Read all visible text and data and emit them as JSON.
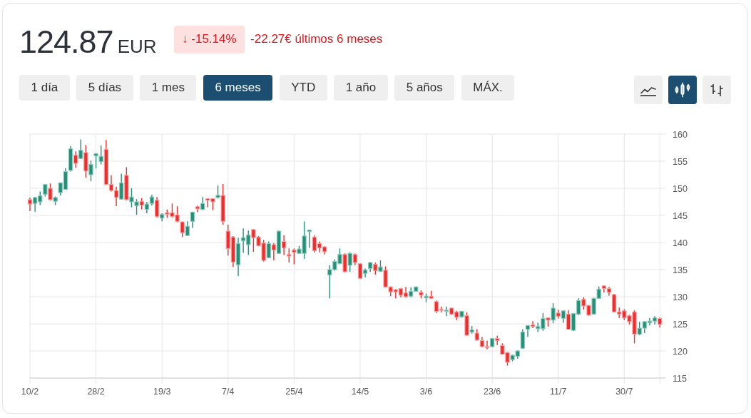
{
  "quote": {
    "price": "124.87",
    "currency": "EUR"
  },
  "change": {
    "badge": "↓ -15.14%",
    "period": "-22.27€ últimos 6 meses"
  },
  "ranges": [
    {
      "label": "1 día",
      "selected": false
    },
    {
      "label": "5 días",
      "selected": false
    },
    {
      "label": "1 mes",
      "selected": false
    },
    {
      "label": "6 meses",
      "selected": true
    },
    {
      "label": "YTD",
      "selected": false
    },
    {
      "label": "1 año",
      "selected": false
    },
    {
      "label": "5 años",
      "selected": false
    },
    {
      "label": "MÁX.",
      "selected": false
    }
  ],
  "chart_types": [
    {
      "kind": "line",
      "selected": false
    },
    {
      "kind": "candlestick",
      "selected": true
    },
    {
      "kind": "ohlc",
      "selected": false
    }
  ],
  "chart": {
    "chart_data": {
      "type": "candlestick",
      "grid": true,
      "ylim": [
        115,
        160
      ],
      "yticks": [
        115,
        120,
        125,
        130,
        135,
        140,
        145,
        150,
        155,
        160
      ],
      "categories": [
        "10/2",
        null,
        null,
        null,
        null,
        null,
        null,
        null,
        null,
        null,
        null,
        null,
        null,
        "28/2",
        null,
        null,
        null,
        null,
        null,
        null,
        null,
        null,
        null,
        null,
        null,
        null,
        "19/3",
        null,
        null,
        null,
        null,
        null,
        null,
        null,
        null,
        null,
        null,
        null,
        null,
        "7/4",
        null,
        null,
        null,
        null,
        null,
        null,
        null,
        null,
        null,
        null,
        null,
        null,
        "25/4",
        null,
        null,
        null,
        null,
        null,
        null,
        null,
        null,
        null,
        null,
        null,
        null,
        "14/5",
        null,
        null,
        null,
        null,
        null,
        null,
        null,
        null,
        null,
        null,
        null,
        null,
        "3/6",
        null,
        null,
        null,
        null,
        null,
        null,
        null,
        null,
        null,
        null,
        null,
        null,
        "23/6",
        null,
        null,
        null,
        null,
        null,
        null,
        null,
        null,
        null,
        null,
        null,
        null,
        "11/7",
        null,
        null,
        null,
        null,
        null,
        null,
        null,
        null,
        null,
        null,
        null,
        null,
        "30/7",
        null,
        null,
        null,
        null,
        null,
        null,
        null
      ],
      "ohlc": [
        [
          147.9,
          148.3,
          145.8,
          147.1
        ],
        [
          147.2,
          148.4,
          145.7,
          148.3
        ],
        [
          147.5,
          149.4,
          146.9,
          148.6
        ],
        [
          148.9,
          150.8,
          148.5,
          150.7
        ],
        [
          150.0,
          150.9,
          147.8,
          147.9
        ],
        [
          147.6,
          148.5,
          146.9,
          148.3
        ],
        [
          149.2,
          151.1,
          148.7,
          151.0
        ],
        [
          149.8,
          153.7,
          149.7,
          153.1
        ],
        [
          153.3,
          157.8,
          153.1,
          157.3
        ],
        [
          156.1,
          156.8,
          153.8,
          154.6
        ],
        [
          155.5,
          159.0,
          155.4,
          157.0
        ],
        [
          156.6,
          158.0,
          152.0,
          153.2
        ],
        [
          152.5,
          155.1,
          151.3,
          154.4
        ],
        [
          156.0,
          156.5,
          153.7,
          156.4
        ],
        [
          154.9,
          157.9,
          154.4,
          155.9
        ],
        [
          157.2,
          158.9,
          150.6,
          150.7
        ],
        [
          150.7,
          152.4,
          149.4,
          149.6
        ],
        [
          149.6,
          150.3,
          146.7,
          148.3
        ],
        [
          148.0,
          152.7,
          147.9,
          151.0
        ],
        [
          152.4,
          153.9,
          147.8,
          147.9
        ],
        [
          147.5,
          150.0,
          146.5,
          148.4
        ],
        [
          146.8,
          148.0,
          145.1,
          147.5
        ],
        [
          147.6,
          148.2,
          146.1,
          146.9
        ],
        [
          146.1,
          147.5,
          145.4,
          147.1
        ],
        [
          147.2,
          148.8,
          146.8,
          148.4
        ],
        [
          147.8,
          148.4,
          144.6,
          144.8
        ],
        [
          144.5,
          145.4,
          143.9,
          145.2
        ],
        [
          145.5,
          146.1,
          144.6,
          145.2
        ],
        [
          145.5,
          147.2,
          144.6,
          144.8
        ],
        [
          145.1,
          146.7,
          143.7,
          143.9
        ],
        [
          143.8,
          143.9,
          141.0,
          141.8
        ],
        [
          141.3,
          143.9,
          141.2,
          143.0
        ],
        [
          143.9,
          145.7,
          142.7,
          145.6
        ],
        [
          146.6,
          146.8,
          145.6,
          146.2
        ],
        [
          146.1,
          148.4,
          146.0,
          147.2
        ],
        [
          148.1,
          148.2,
          146.5,
          147.8
        ],
        [
          148.1,
          148.2,
          146.0,
          147.5
        ],
        [
          148.3,
          150.5,
          148.1,
          148.7
        ],
        [
          148.7,
          150.8,
          143.3,
          143.9
        ],
        [
          142.1,
          143.3,
          137.6,
          138.9
        ],
        [
          141.0,
          141.2,
          135.5,
          136.4
        ],
        [
          135.9,
          140.9,
          133.8,
          139.8
        ],
        [
          140.3,
          142.6,
          138.1,
          140.9
        ],
        [
          139.6,
          142.2,
          137.7,
          141.4
        ],
        [
          142.4,
          142.4,
          138.3,
          140.9
        ],
        [
          141.0,
          141.2,
          139.3,
          139.4
        ],
        [
          139.9,
          140.5,
          136.5,
          136.7
        ],
        [
          137.2,
          140.2,
          137.1,
          139.8
        ],
        [
          139.6,
          139.9,
          136.7,
          138.6
        ],
        [
          138.0,
          142.2,
          137.9,
          142.1
        ],
        [
          140.2,
          141.3,
          137.7,
          139.0
        ],
        [
          137.8,
          138.9,
          136.3,
          137.5
        ],
        [
          138.6,
          138.9,
          136.0,
          138.2
        ],
        [
          138.0,
          139.4,
          137.9,
          138.8
        ],
        [
          138.0,
          143.9,
          137.0,
          141.2
        ],
        [
          142.0,
          142.4,
          139.0,
          142.3
        ],
        [
          141.0,
          141.3,
          138.2,
          138.5
        ],
        [
          139.8,
          140.2,
          138.2,
          139.0
        ],
        [
          139.2,
          139.3,
          137.8,
          138.3
        ],
        [
          134.0,
          135.8,
          129.7,
          135.0
        ],
        [
          135.0,
          136.9,
          134.8,
          136.5
        ],
        [
          136.1,
          138.9,
          136.0,
          137.8
        ],
        [
          137.8,
          138.0,
          134.5,
          134.6
        ],
        [
          135.8,
          138.2,
          134.6,
          138.0
        ],
        [
          137.8,
          138.0,
          135.8,
          136.3
        ],
        [
          136.1,
          136.2,
          133.3,
          133.4
        ],
        [
          134.3,
          135.2,
          133.6,
          134.9
        ],
        [
          135.2,
          136.4,
          134.6,
          136.3
        ],
        [
          136.0,
          136.3,
          134.1,
          134.8
        ],
        [
          134.7,
          136.7,
          134.6,
          135.5
        ],
        [
          134.9,
          135.6,
          131.7,
          131.8
        ],
        [
          131.8,
          131.9,
          130.1,
          130.9
        ],
        [
          131.3,
          131.4,
          129.7,
          130.9
        ],
        [
          131.5,
          131.6,
          129.9,
          130.3
        ],
        [
          130.7,
          131.8,
          129.8,
          130.0
        ],
        [
          130.1,
          131.7,
          129.9,
          131.0
        ],
        [
          131.0,
          131.9,
          130.9,
          131.8
        ],
        [
          130.8,
          131.2,
          129.7,
          130.3
        ],
        [
          129.8,
          130.6,
          129.0,
          130.1
        ],
        [
          130.1,
          131.1,
          129.6,
          129.7
        ],
        [
          129.1,
          129.3,
          127.0,
          127.3
        ],
        [
          127.7,
          128.2,
          127.1,
          127.5
        ],
        [
          127.3,
          128.2,
          126.4,
          127.5
        ],
        [
          127.9,
          128.0,
          126.6,
          126.8
        ],
        [
          127.2,
          127.4,
          125.7,
          126.2
        ],
        [
          126.3,
          127.4,
          126.1,
          127.3
        ],
        [
          126.5,
          127.1,
          122.8,
          122.9
        ],
        [
          123.5,
          124.6,
          123.2,
          123.9
        ],
        [
          123.3,
          124.0,
          121.9,
          122.0
        ],
        [
          121.9,
          122.6,
          120.7,
          120.8
        ],
        [
          120.8,
          121.9,
          120.3,
          120.6
        ],
        [
          120.8,
          122.4,
          120.7,
          122.3
        ],
        [
          122.3,
          122.8,
          121.1,
          121.9
        ],
        [
          121.0,
          121.4,
          119.3,
          119.4
        ],
        [
          119.7,
          119.8,
          117.3,
          117.9
        ],
        [
          118.4,
          119.3,
          118.1,
          119.2
        ],
        [
          119.0,
          120.1,
          118.6,
          120.0
        ],
        [
          120.5,
          124.0,
          120.4,
          123.5
        ],
        [
          124.0,
          124.7,
          122.6,
          124.7
        ],
        [
          124.8,
          125.5,
          124.2,
          124.5
        ],
        [
          124.1,
          125.2,
          123.5,
          124.5
        ],
        [
          124.1,
          127.0,
          123.7,
          126.0
        ],
        [
          126.1,
          126.2,
          124.5,
          125.7
        ],
        [
          125.7,
          128.8,
          125.1,
          127.9
        ],
        [
          127.0,
          127.6,
          126.0,
          126.4
        ],
        [
          126.0,
          127.5,
          125.2,
          127.4
        ],
        [
          126.8,
          127.5,
          123.9,
          124.0
        ],
        [
          123.8,
          127.0,
          123.7,
          126.9
        ],
        [
          126.8,
          129.7,
          126.6,
          129.3
        ],
        [
          129.5,
          129.9,
          127.6,
          128.3
        ],
        [
          128.4,
          128.5,
          126.5,
          126.6
        ],
        [
          126.8,
          129.8,
          126.7,
          129.7
        ],
        [
          129.7,
          131.9,
          129.6,
          131.4
        ],
        [
          132.0,
          132.1,
          130.8,
          131.5
        ],
        [
          131.5,
          131.8,
          130.2,
          130.8
        ],
        [
          130.4,
          130.5,
          127.1,
          127.2
        ],
        [
          127.2,
          128.0,
          126.1,
          126.8
        ],
        [
          127.4,
          127.7,
          125.7,
          126.1
        ],
        [
          126.5,
          126.7,
          124.9,
          125.4
        ],
        [
          127.2,
          127.5,
          121.4,
          123.1
        ],
        [
          123.1,
          125.4,
          122.9,
          124.2
        ],
        [
          124.2,
          125.5,
          123.3,
          125.4
        ],
        [
          125.2,
          126.1,
          124.7,
          125.5
        ],
        [
          125.5,
          126.4,
          124.9,
          126.1
        ],
        [
          126.0,
          126.2,
          124.3,
          124.9
        ]
      ]
    }
  }
}
